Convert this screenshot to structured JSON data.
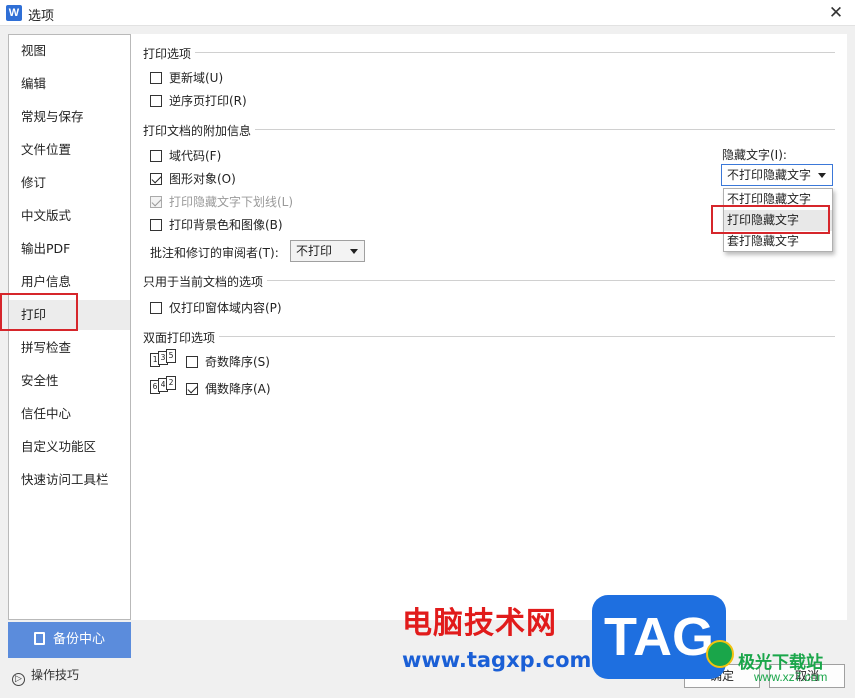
{
  "window": {
    "title": "选项",
    "app_icon": "W",
    "close_symbol": "✕"
  },
  "sidebar": {
    "items": [
      {
        "label": "视图"
      },
      {
        "label": "编辑"
      },
      {
        "label": "常规与保存"
      },
      {
        "label": "文件位置"
      },
      {
        "label": "修订"
      },
      {
        "label": "中文版式"
      },
      {
        "label": "输出PDF"
      },
      {
        "label": "用户信息"
      },
      {
        "label": "打印",
        "active": true
      },
      {
        "label": "拼写检查"
      },
      {
        "label": "安全性"
      },
      {
        "label": "信任中心"
      },
      {
        "label": "自定义功能区"
      },
      {
        "label": "快速访问工具栏"
      }
    ],
    "backup_label": "备份中心",
    "tips_label": "操作技巧"
  },
  "sections": {
    "print_options": {
      "title": "打印选项",
      "update_fields": {
        "label": "更新域(U)",
        "checked": false
      },
      "reverse_order": {
        "label": "逆序页打印(R)",
        "checked": false
      }
    },
    "additional_info": {
      "title": "打印文档的附加信息",
      "field_codes": {
        "label": "域代码(F)",
        "checked": false
      },
      "drawing_objects": {
        "label": "图形对象(O)",
        "checked": true
      },
      "hidden_text_underline": {
        "label": "打印隐藏文字下划线(L)",
        "checked": true,
        "disabled": true
      },
      "background": {
        "label": "打印背景色和图像(B)",
        "checked": false
      },
      "reviewer_label": "批注和修订的审阅者(T):",
      "reviewer_value": "不打印",
      "hidden_text_label": "隐藏文字(I):",
      "hidden_text_value": "不打印隐藏文字",
      "hidden_text_options": [
        "不打印隐藏文字",
        "打印隐藏文字",
        "套打隐藏文字"
      ],
      "hovered_option_index": 1
    },
    "current_doc": {
      "title": "只用于当前文档的选项",
      "form_fields_only": {
        "label": "仅打印窗体域内容(P)",
        "checked": false
      }
    },
    "duplex": {
      "title": "双面打印选项",
      "odd_reverse": {
        "label": "奇数降序(S)",
        "checked": false,
        "pages": [
          "1",
          "3",
          "5"
        ]
      },
      "even_reverse": {
        "label": "偶数降序(A)",
        "checked": true,
        "pages": [
          "6",
          "4",
          "2"
        ]
      }
    }
  },
  "footer": {
    "ok_label": "确定",
    "cancel_label": "取消"
  },
  "watermark": {
    "text": "电脑技术网",
    "url": "www.tagxp.com",
    "tag": "TAG",
    "site_name": "极光下载站",
    "site_url": "www.xz7.com"
  },
  "colors": {
    "accent": "#5b8cdc",
    "highlight_box": "#d6262b"
  }
}
